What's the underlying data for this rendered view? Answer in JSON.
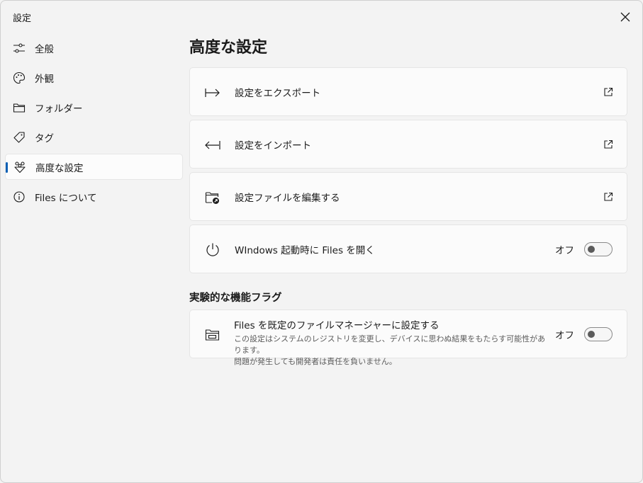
{
  "window": {
    "title": "設定"
  },
  "nav": {
    "items": [
      {
        "label": "全般",
        "icon": "sliders-icon"
      },
      {
        "label": "外観",
        "icon": "palette-icon"
      },
      {
        "label": "フォルダー",
        "icon": "folder-icon"
      },
      {
        "label": "タグ",
        "icon": "tag-icon"
      },
      {
        "label": "高度な設定",
        "icon": "advanced-icon",
        "selected": true
      },
      {
        "label": "Files について",
        "icon": "info-icon"
      }
    ]
  },
  "main": {
    "title": "高度な設定",
    "cards": [
      {
        "label": "設定をエクスポート",
        "icon": "export-icon"
      },
      {
        "label": "設定をインポート",
        "icon": "import-icon"
      },
      {
        "label": "設定ファイルを編集する",
        "icon": "folder-shortcut-icon"
      }
    ],
    "startup": {
      "label": "WIndows 起動時に Files を開く",
      "state": "オフ"
    },
    "experimental": {
      "title": "実験的な機能フラグ",
      "default_manager": {
        "label": "Files を既定のファイルマネージャーに設定する",
        "desc_line1": "この設定はシステムのレジストリを変更し、デバイスに思わぬ結果をもたらす可能性があります。",
        "desc_line2": "問題が発生しても開発者は責任を負いません。",
        "state": "オフ"
      }
    }
  },
  "colors": {
    "accent": "#0a5fb4",
    "background": "#f3f3f3",
    "card": "#fbfbfb"
  }
}
